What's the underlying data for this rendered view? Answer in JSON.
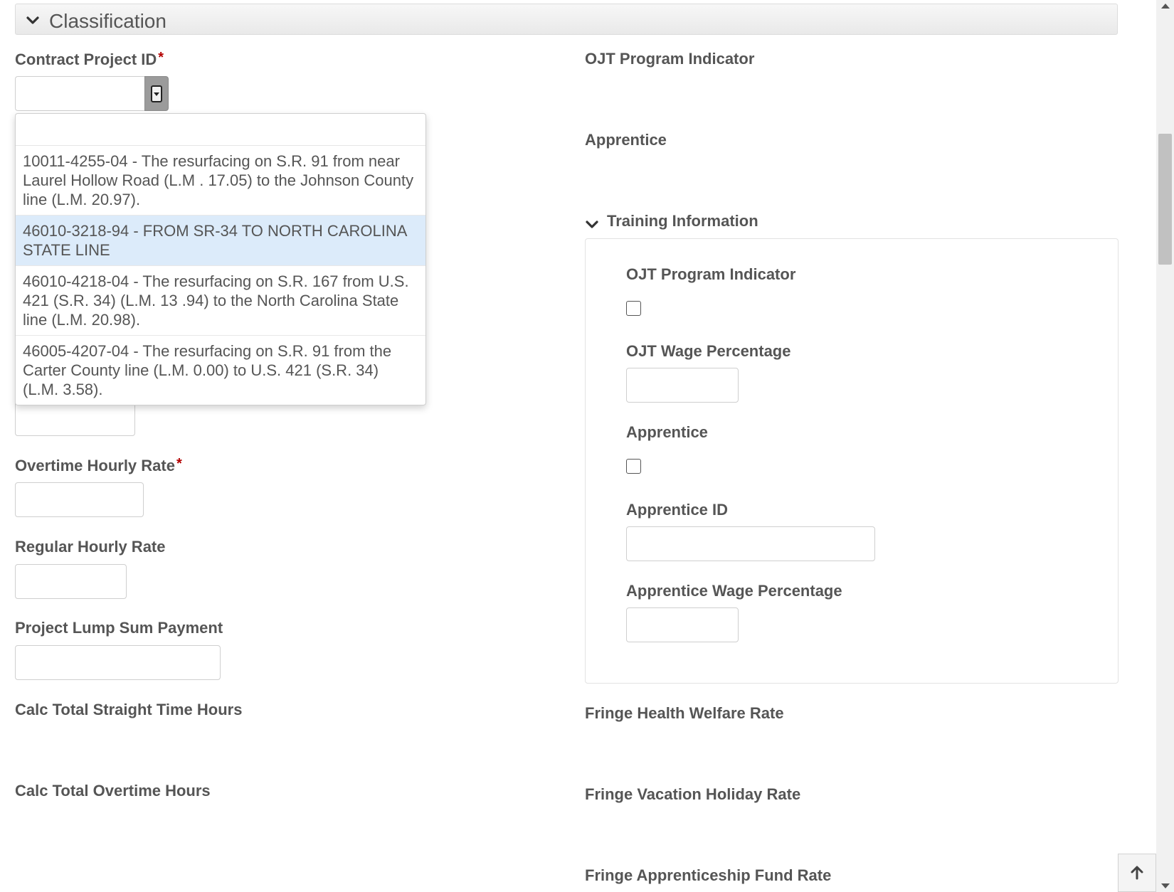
{
  "section": {
    "title": "Classification",
    "icon": "chevron-down-icon"
  },
  "left": {
    "contract_project_id": {
      "label": "Contract Project ID",
      "required_mark": "*",
      "value": ""
    },
    "overtime_hourly_rate": {
      "label": "Overtime Hourly Rate",
      "required_mark": "*",
      "value": ""
    },
    "regular_hourly_rate": {
      "label": "Regular Hourly Rate",
      "value": ""
    },
    "project_lump_sum_payment": {
      "label": "Project Lump Sum Payment",
      "value": ""
    },
    "calc_total_straight_time_hours": {
      "label": "Calc Total Straight Time Hours"
    },
    "calc_total_overtime_hours": {
      "label": "Calc Total Overtime Hours"
    }
  },
  "dropdown": {
    "filter_value": "",
    "items": [
      {
        "label": "10011-4255-04 - The resurfacing on S.R. 91 from near Laurel Hollow Road (L.M . 17.05) to the Johnson County line (L.M. 20.97).",
        "selected": false
      },
      {
        "label": "46010-3218-94 - FROM SR-34 TO NORTH CAROLINA STATE LINE",
        "selected": true
      },
      {
        "label": "46010-4218-04 - The resurfacing on S.R. 167 from U.S. 421 (S.R. 34) (L.M. 13 .94) to the North Carolina State line (L.M. 20.98).",
        "selected": false
      },
      {
        "label": "46005-4207-04 - The resurfacing on S.R. 91 from the Carter County line (L.M. 0.00) to U.S. 421 (S.R. 34) (L.M. 3.58).",
        "selected": false
      }
    ]
  },
  "right": {
    "ojt_program_indicator": {
      "label": "OJT Program Indicator"
    },
    "apprentice": {
      "label": "Apprentice"
    },
    "training": {
      "title": "Training Information",
      "ojt_program_indicator": {
        "label": "OJT Program Indicator",
        "checked": false
      },
      "ojt_wage_percentage": {
        "label": "OJT Wage Percentage",
        "value": ""
      },
      "apprentice": {
        "label": "Apprentice",
        "checked": false
      },
      "apprentice_id": {
        "label": "Apprentice ID",
        "value": ""
      },
      "apprentice_wage_percentage": {
        "label": "Apprentice Wage Percentage",
        "value": ""
      }
    },
    "fringe_health_welfare_rate": {
      "label": "Fringe Health Welfare Rate"
    },
    "fringe_vacation_holiday_rate": {
      "label": "Fringe Vacation Holiday Rate"
    },
    "fringe_apprenticeship_fund_rate": {
      "label": "Fringe Apprenticeship Fund Rate"
    }
  },
  "scroll_to_top": {
    "icon": "arrow-up-icon"
  }
}
